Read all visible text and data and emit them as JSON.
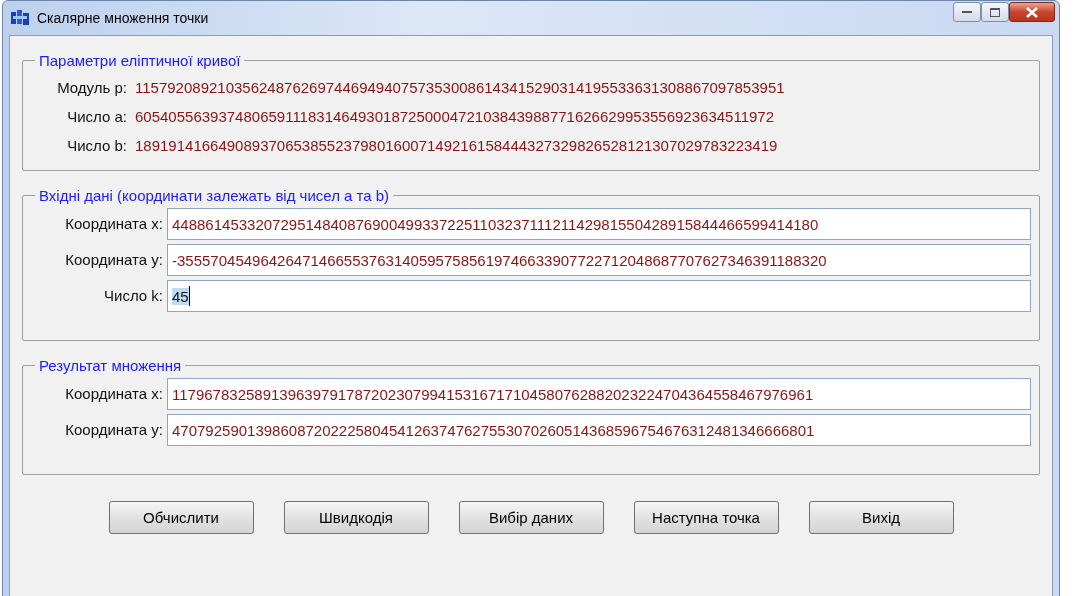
{
  "window": {
    "title": "Скалярне множення точки"
  },
  "groups": [
    {
      "title": "Параметри еліптичної кривої",
      "kind": "readout",
      "rows": [
        {
          "label": "Модуль p:",
          "value": "115792089210356248762697446949407573530086143415290314195533631308867097853951"
        },
        {
          "label": "Число a:",
          "value": "60540556393748065911183146493018725000472103843988771626629953556923634511972"
        },
        {
          "label": "Число b:",
          "value": "18919141664908937065385523798016007149216158444327329826528121307029783223419"
        }
      ]
    },
    {
      "title": "Вхідні дані (координати залежать від чисел a та b)",
      "kind": "fields",
      "rows": [
        {
          "label": "Координата x:",
          "value": "448861453320729514840876900499337225110323711121142981550428915844466599414180",
          "text_selected": false
        },
        {
          "label": "Координата y:",
          "value": "-355570454964264714665537631405957585619746633907722712048687707627346391188320",
          "text_selected": false
        },
        {
          "label": "Число k:",
          "value": "45",
          "text_selected": true
        }
      ]
    },
    {
      "title": "Результат множення",
      "kind": "fields",
      "rows": [
        {
          "label": "Координата x:",
          "value": "11796783258913963979178720230799415316717104580762882023224704364558467976961",
          "text_selected": false
        },
        {
          "label": "Координата y:",
          "value": "47079259013986087202225804541263747627553070260514368596754676312481346666801",
          "text_selected": false
        }
      ]
    }
  ],
  "buttons": [
    "Обчислити",
    "Швидкодія",
    "Вибір даних",
    "Наступна точка",
    "Вихід"
  ]
}
